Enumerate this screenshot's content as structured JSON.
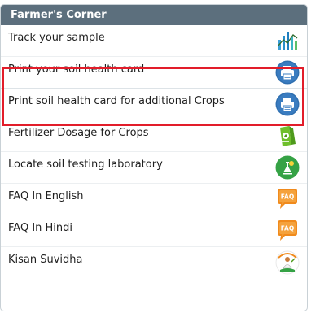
{
  "panel": {
    "title": "Farmer's Corner"
  },
  "items": [
    {
      "label": "Track your sample",
      "icon": "track-sample-icon"
    },
    {
      "label": "Print your soil health card",
      "icon": "printer-icon"
    },
    {
      "label": "Print soil health card for additional Crops",
      "icon": "printer-icon"
    },
    {
      "label": "Fertilizer Dosage for Crops",
      "icon": "fertilizer-icon"
    },
    {
      "label": "Locate soil testing laboratory",
      "icon": "locate-lab-icon"
    },
    {
      "label": "FAQ In English",
      "icon": "faq-icon",
      "icon_text": "FAQ"
    },
    {
      "label": "FAQ In Hindi",
      "icon": "faq-icon",
      "icon_text": "FAQ"
    },
    {
      "label": "Kisan Suvidha",
      "icon": "kisan-suvidha-icon"
    }
  ],
  "colors": {
    "header_bg": "#5c6f7d",
    "highlight": "#e21d2a",
    "printer_blue": "#2f6fb0",
    "faq_orange": "#f08a1c",
    "fertilizer_green": "#6fbf2c",
    "locate_green": "#35a245"
  }
}
